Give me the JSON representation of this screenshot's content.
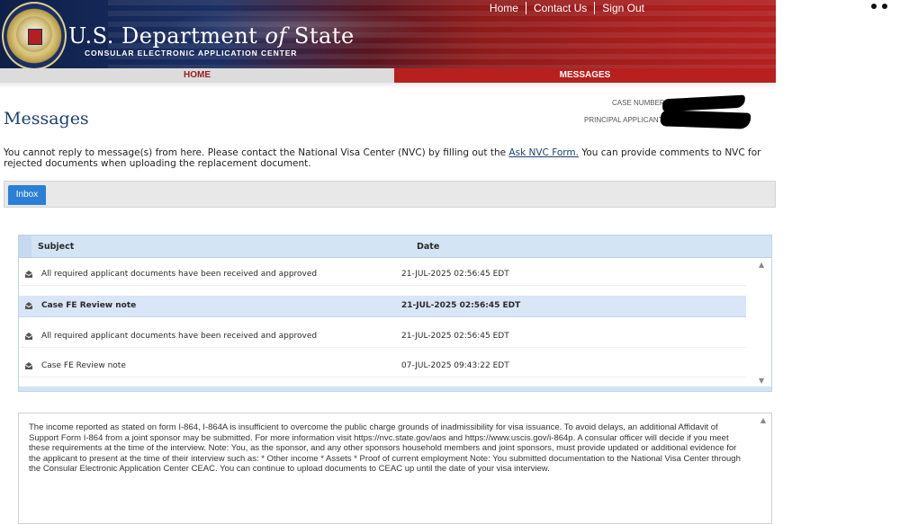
{
  "header": {
    "title_main": "U.S. Department",
    "title_of": "of",
    "title_state": "State",
    "subtitle": "CONSULAR ELECTRONIC APPLICATION CENTER",
    "top_links": [
      "Home",
      "Contact Us",
      "Sign Out"
    ]
  },
  "nav": {
    "home": "HOME",
    "messages": "MESSAGES"
  },
  "case": {
    "case_number_label": "CASE NUMBER",
    "principal_label": "PRINCIPAL APPLICANT"
  },
  "page": {
    "title": "Messages",
    "intro_before": "You cannot reply to message(s) from here.  Please contact the National Visa Center (NVC) by filling out the ",
    "intro_link": "Ask NVC Form.",
    "intro_after": "  You can provide comments to NVC for rejected documents when uploading the replacement document."
  },
  "tabs": [
    {
      "label": "Inbox"
    }
  ],
  "table": {
    "columns": [
      "Subject",
      "Date"
    ],
    "rows": [
      {
        "subject": "All required applicant documents have been received and approved",
        "date": "21-JUL-2025 02:56:45 EDT"
      },
      {
        "subject": "Case FE Review note",
        "date": "21-JUL-2025 02:56:45 EDT"
      },
      {
        "subject": "All required applicant documents have been received and approved",
        "date": "21-JUL-2025 02:56:45 EDT"
      },
      {
        "subject": "Case FE Review note",
        "date": "07-JUL-2025 09:43:22 EDT"
      }
    ]
  },
  "message_body": "The income reported as stated on form I-864, I-864A is insufficient to overcome the public charge grounds of inadmissibility for visa issuance. To avoid delays, an additional Affidavit of Support Form I-864 from a joint sponsor may be submitted. For more information visit https://nvc.state.gov/aos and https://www.uscis.gov/i-864p. A consular officer will decide if you meet these requirements at the time of the interview. Note: You, as the sponsor, and any other sponsors household members and joint sponsors, must provide updated or additional evidence for the applicant to present at the time of their interview such as: * Other income * Assets * Proof of current employment Note: You submitted documentation to the National Visa Center through the Consular Electronic Application Center CEAC. You can continue to upload documents to CEAC up until the date of your visa interview.",
  "colors": {
    "navy": "#1c2f63",
    "red": "#b81f1f",
    "tab_blue": "#2a7fd6",
    "row_selected": "#d9e6f7"
  }
}
